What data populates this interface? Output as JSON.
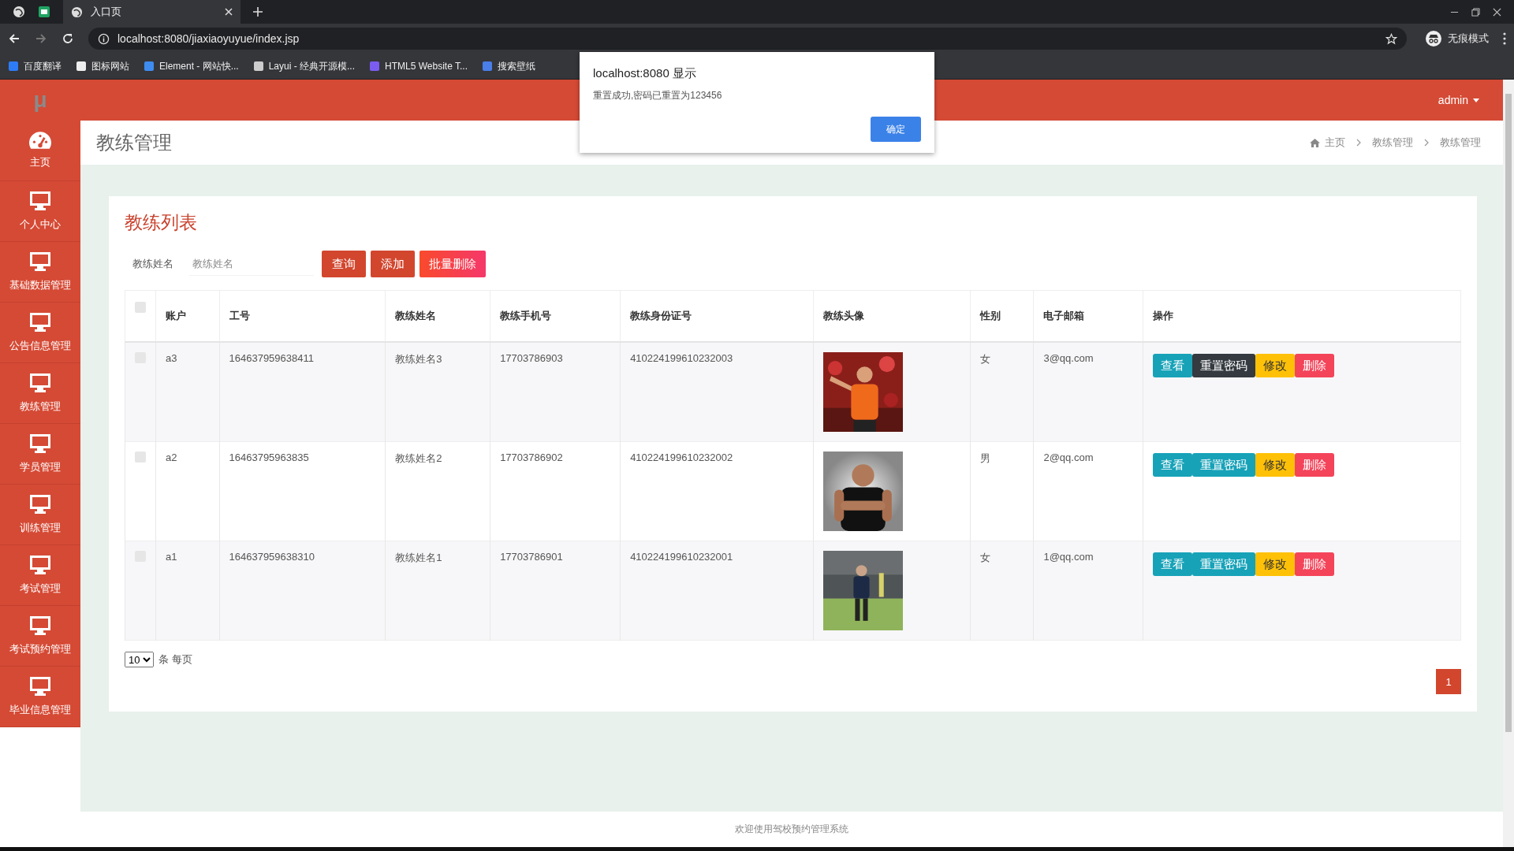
{
  "browser": {
    "tabs": [
      {
        "title": "入口页",
        "selected": true
      }
    ],
    "url": "localhost:8080/jiaxiaoyuyue/index.jsp",
    "bookmarks": [
      "百度翻译",
      "图标网站",
      "Element - 网站快...",
      "Layui - 经典开源模...",
      "HTML5 Website T...",
      "搜索壁纸"
    ],
    "profile": "无痕模式"
  },
  "dialog": {
    "title": "localhost:8080 显示",
    "message": "重置成功,密码已重置为123456",
    "button": "确定"
  },
  "navbar": {
    "logo": "μ",
    "user": "admin"
  },
  "sidebar": {
    "items": [
      {
        "label": "主页",
        "kind": "dashboard"
      },
      {
        "label": "个人中心",
        "kind": "page"
      },
      {
        "label": "基础数据管理",
        "kind": "page"
      },
      {
        "label": "公告信息管理",
        "kind": "page"
      },
      {
        "label": "教练管理",
        "kind": "page"
      },
      {
        "label": "学员管理",
        "kind": "page"
      },
      {
        "label": "训练管理",
        "kind": "page"
      },
      {
        "label": "考试管理",
        "kind": "page"
      },
      {
        "label": "考试预约管理",
        "kind": "page"
      },
      {
        "label": "毕业信息管理",
        "kind": "page"
      }
    ]
  },
  "page_header": {
    "title": "教练管理",
    "breadcrumb": [
      "主页",
      "教练管理",
      "教练管理"
    ]
  },
  "panel": {
    "title": "教练列表",
    "search": {
      "label": "教练姓名",
      "placeholder": "教练姓名"
    },
    "buttons": [
      {
        "label": "查询",
        "kind": "search"
      },
      {
        "label": "添加",
        "kind": "add"
      },
      {
        "label": "批量删除",
        "kind": "delete"
      }
    ]
  },
  "table": {
    "header_checked": false,
    "columns": [
      "账户",
      "工号",
      "教练姓名",
      "教练手机号",
      "教练身份证号",
      "教练头像",
      "性别",
      "电子邮箱",
      "操作"
    ],
    "rows": [
      {
        "checked": false,
        "account": "a3",
        "number": "164637959638411",
        "name": "教练姓名3",
        "phone": "17703786903",
        "id_card": "410224199610232003",
        "gender": "女",
        "email": "3@qq.com",
        "actions": [
          {
            "label": "查看",
            "kind": "view",
            "highlighted": false
          },
          {
            "label": "重置密码",
            "kind": "reset",
            "highlighted": true
          },
          {
            "label": "修改",
            "kind": "edit",
            "highlighted": false
          },
          {
            "label": "删除",
            "kind": "delete",
            "highlighted": false
          }
        ]
      },
      {
        "checked": false,
        "account": "a2",
        "number": "16463795963835",
        "name": "教练姓名2",
        "phone": "17703786902",
        "id_card": "410224199610232002",
        "gender": "男",
        "email": "2@qq.com",
        "actions": [
          {
            "label": "查看",
            "kind": "view",
            "highlighted": false
          },
          {
            "label": "重置密码",
            "kind": "reset",
            "highlighted": false
          },
          {
            "label": "修改",
            "kind": "edit",
            "highlighted": false
          },
          {
            "label": "删除",
            "kind": "delete",
            "highlighted": false
          }
        ]
      },
      {
        "checked": false,
        "account": "a1",
        "number": "164637959638310",
        "name": "教练姓名1",
        "phone": "17703786901",
        "id_card": "410224199610232001",
        "gender": "女",
        "email": "1@qq.com",
        "actions": [
          {
            "label": "查看",
            "kind": "view",
            "highlighted": false
          },
          {
            "label": "重置密码",
            "kind": "reset",
            "highlighted": false
          },
          {
            "label": "修改",
            "kind": "edit",
            "highlighted": false
          },
          {
            "label": "删除",
            "kind": "delete",
            "highlighted": false
          }
        ]
      }
    ]
  },
  "pagination": {
    "page_size": "10",
    "page_size_suffix": "条 每页",
    "pages": [
      {
        "label": "1",
        "selected": true
      }
    ]
  },
  "footer": "欢迎使用驾校预约管理系统"
}
